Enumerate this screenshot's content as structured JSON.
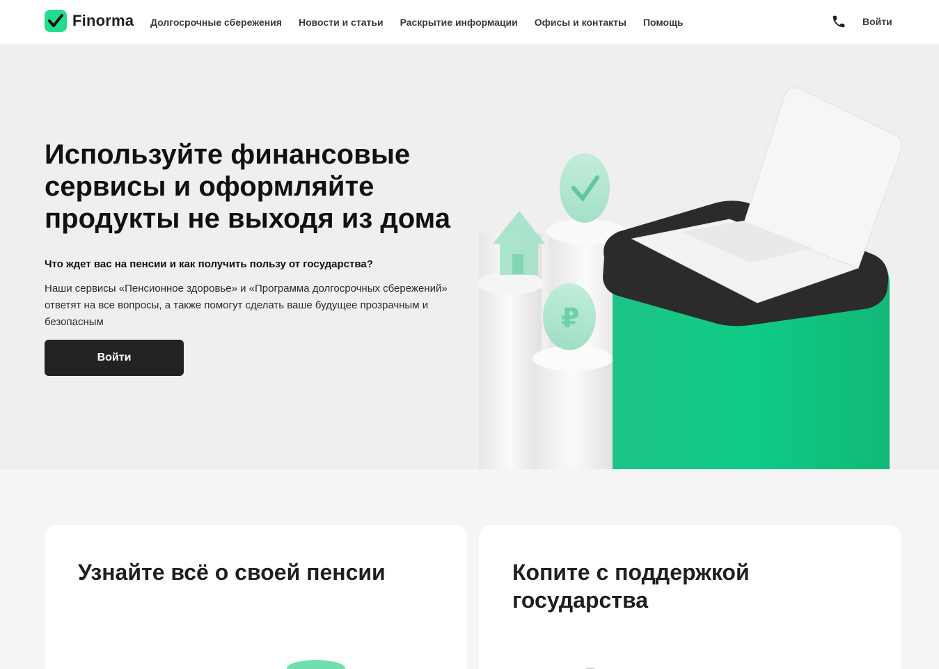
{
  "header": {
    "brand": "Finorma",
    "nav": [
      "Долгосрочные сбережения",
      "Новости и статьи",
      "Раскрытие информации",
      "Офисы и контакты",
      "Помощь"
    ],
    "phone_icon": "phone-icon",
    "login_label": "Войти"
  },
  "hero": {
    "title": "Используйте финансовые сервисы и оформляйте продукты не выходя из дома",
    "subtitle": "Что ждет вас на пенсии и как получить пользу от государства?",
    "description": "Наши сервисы «Пенсионное здоровье» и «Программа долгосрочных сбережений» ответят на все вопросы, а также помогут сделать ваше будущее прозрачным и безопасным",
    "button_label": "Войти"
  },
  "cards": [
    {
      "title": "Узнайте всё о своей пенсии"
    },
    {
      "title": "Копите с поддержкой государства"
    }
  ],
  "colors": {
    "brand_green": "#21dc8c",
    "button_dark": "#222222",
    "hero_bg": "#efefef"
  }
}
